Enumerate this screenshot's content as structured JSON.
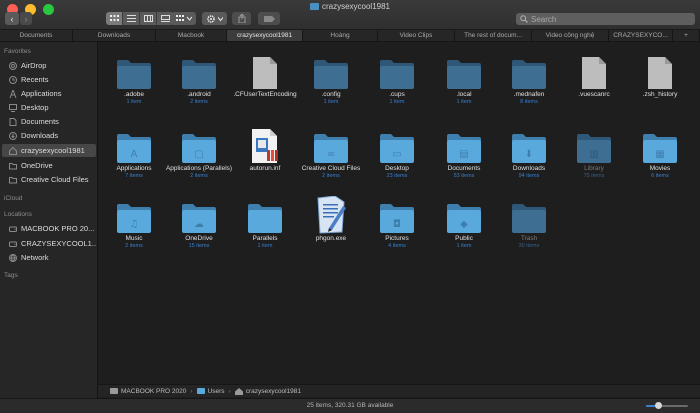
{
  "window": {
    "title": "crazysexycool1981"
  },
  "toolbar": {
    "back": "‹",
    "forward": "›",
    "search_placeholder": "Search"
  },
  "tabs": [
    {
      "label": "Documents"
    },
    {
      "label": "Downloads"
    },
    {
      "label": "Macbook"
    },
    {
      "label": "crazysexycool1981"
    },
    {
      "label": "Hoàng"
    },
    {
      "label": "Video Clips"
    },
    {
      "label": "The rest of docum..."
    },
    {
      "label": "Video công nghệ"
    },
    {
      "label": "CRAZYSEXYCO..."
    },
    {
      "label": "+"
    }
  ],
  "sidebar": {
    "favorites_heading": "Favorites",
    "favorites": [
      {
        "label": "AirDrop",
        "icon": "airdrop-icon"
      },
      {
        "label": "Recents",
        "icon": "clock-icon"
      },
      {
        "label": "Applications",
        "icon": "applications-icon"
      },
      {
        "label": "Desktop",
        "icon": "desktop-icon"
      },
      {
        "label": "Documents",
        "icon": "document-icon"
      },
      {
        "label": "Downloads",
        "icon": "download-icon"
      },
      {
        "label": "crazysexycool1981",
        "icon": "home-icon"
      },
      {
        "label": "OneDrive",
        "icon": "folder-icon"
      },
      {
        "label": "Creative Cloud Files",
        "icon": "folder-icon"
      }
    ],
    "icloud_heading": "iCloud",
    "locations_heading": "Locations",
    "locations": [
      {
        "label": "MACBOOK PRO 20...",
        "icon": "disk-icon"
      },
      {
        "label": "CRAZYSEXYCOOL1...",
        "icon": "disk-icon"
      },
      {
        "label": "Network",
        "icon": "network-icon"
      }
    ],
    "tags_heading": "Tags"
  },
  "files": [
    {
      "name": ".adobe",
      "sub": "1 item",
      "type": "folder"
    },
    {
      "name": ".android",
      "sub": "2 items",
      "type": "folder"
    },
    {
      "name": ".CFUserTextEncoding",
      "sub": "",
      "type": "file"
    },
    {
      "name": ".config",
      "sub": "1 item",
      "type": "folder"
    },
    {
      "name": ".cups",
      "sub": "1 item",
      "type": "folder"
    },
    {
      "name": ".local",
      "sub": "1 item",
      "type": "folder"
    },
    {
      "name": ".mednafen",
      "sub": "8 items",
      "type": "folder"
    },
    {
      "name": ".vuescanrc",
      "sub": "",
      "type": "file"
    },
    {
      "name": ".zsh_history",
      "sub": "",
      "type": "file"
    },
    {
      "name": "Applications",
      "sub": "7 items",
      "type": "folder",
      "glyph": "A"
    },
    {
      "name": "Applications (Parallels)",
      "sub": "2 items",
      "type": "folder",
      "glyph": "▢"
    },
    {
      "name": "autorun.inf",
      "sub": "",
      "type": "inf"
    },
    {
      "name": "Creative Cloud Files",
      "sub": "2 items",
      "type": "folder",
      "glyph": "∞"
    },
    {
      "name": "Desktop",
      "sub": "23 items",
      "type": "folder",
      "glyph": "▭"
    },
    {
      "name": "Documents",
      "sub": "53 items",
      "type": "folder",
      "glyph": "▤"
    },
    {
      "name": "Downloads",
      "sub": "94 items",
      "type": "folder",
      "glyph": "⬇"
    },
    {
      "name": "Library",
      "sub": "75 items",
      "type": "folder",
      "glyph": "▥",
      "dim": true
    },
    {
      "name": "Movies",
      "sub": "6 items",
      "type": "folder",
      "glyph": "▦"
    },
    {
      "name": "Music",
      "sub": "2 items",
      "type": "folder",
      "glyph": "♫"
    },
    {
      "name": "OneDrive",
      "sub": "15 items",
      "type": "folder",
      "glyph": "☁"
    },
    {
      "name": "Parallels",
      "sub": "1 item",
      "type": "folder"
    },
    {
      "name": "phgon.exe",
      "sub": "",
      "type": "exe"
    },
    {
      "name": "Pictures",
      "sub": "4 items",
      "type": "folder",
      "glyph": "◘"
    },
    {
      "name": "Public",
      "sub": "1 item",
      "type": "folder",
      "glyph": "◆"
    },
    {
      "name": "Trash",
      "sub": "30 items",
      "type": "folder",
      "dim": true
    }
  ],
  "pathbar": {
    "disk": "MACBOOK PRO 2020",
    "sep1": "›",
    "users": "Users",
    "sep2": "›",
    "home": "crazysexycool1981"
  },
  "status": {
    "text": "25 items, 320.31 GB available",
    "zoom_level": 0.3
  },
  "colors": {
    "folder": "#5aa9dc",
    "folder_dark": "#3f7fae",
    "hidden_folder": "#3e6f93",
    "accent": "#3a7fd0"
  }
}
